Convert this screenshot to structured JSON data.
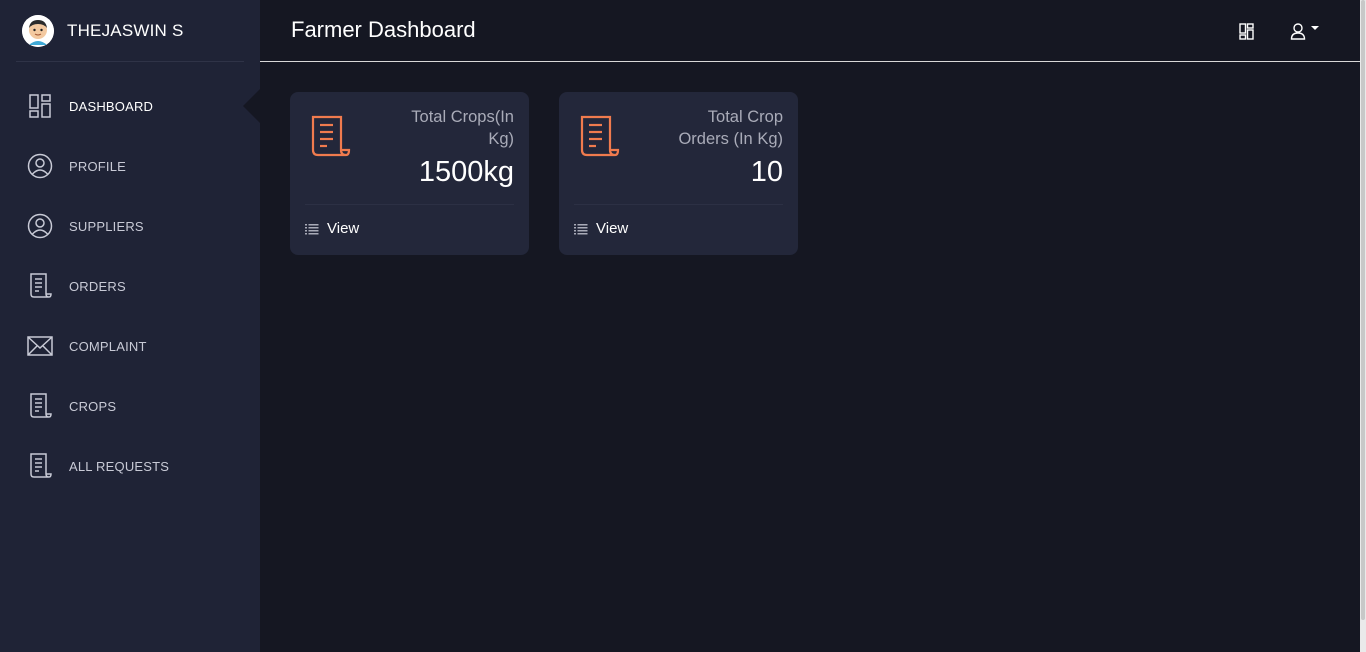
{
  "sidebar": {
    "user_name": "THEJASWIN S",
    "items": [
      {
        "label": "DASHBOARD",
        "icon": "dashboard-icon",
        "active": true
      },
      {
        "label": "PROFILE",
        "icon": "user-circle-icon"
      },
      {
        "label": "SUPPLIERS",
        "icon": "user-circle-icon"
      },
      {
        "label": "ORDERS",
        "icon": "receipt-icon"
      },
      {
        "label": "COMPLAINT",
        "icon": "envelope-icon"
      },
      {
        "label": "CROPS",
        "icon": "receipt-icon"
      },
      {
        "label": "ALL REQUESTS",
        "icon": "receipt-icon"
      }
    ]
  },
  "header": {
    "title": "Farmer Dashboard",
    "icons": [
      "dashboard-icon",
      "user-icon",
      "caret-down-icon"
    ]
  },
  "cards": [
    {
      "label": "Total Crops(In Kg)",
      "value": "1500kg",
      "link": "View",
      "icon": "receipt-icon"
    },
    {
      "label": "Total Crop Orders (In Kg)",
      "value": "10",
      "link": "View",
      "icon": "receipt-icon"
    }
  ],
  "colors": {
    "sidebar_bg": "#1f2336",
    "main_bg": "#151722",
    "card_bg": "#23273a",
    "accent": "#f07b4e"
  }
}
